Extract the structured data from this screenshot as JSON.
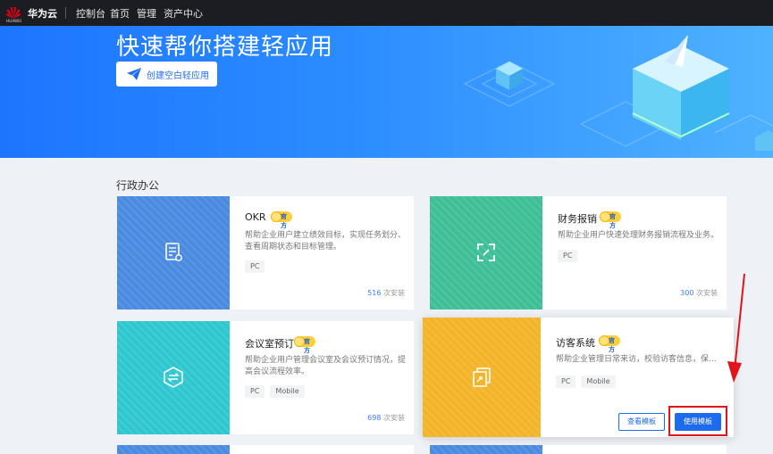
{
  "header": {
    "logo_text": "HUAWEI",
    "brand": "华为云",
    "nav": [
      "控制台",
      "首页",
      "管理",
      "资产中心"
    ]
  },
  "banner": {
    "title": "快速帮你搭建轻应用",
    "create_button": "创建空白轻应用"
  },
  "section": {
    "title": "行政办公"
  },
  "badge_text": "官方",
  "cards": [
    {
      "title": "OKR",
      "desc": "帮助企业用户建立绩效目标，实现任务划分、查看周期状态和目标管理。",
      "tags": [
        "PC"
      ],
      "installs": "516",
      "installs_suffix": "次安装",
      "thumb_color": "#4a8ae0"
    },
    {
      "title": "财务报销",
      "desc": "帮助企业用户快速处理财务报销流程及业务。",
      "tags": [
        "PC"
      ],
      "installs": "300",
      "installs_suffix": "次安装",
      "thumb_color": "#3fbf96"
    },
    {
      "title": "会议室预订",
      "desc": "帮助企业用户管理会议室及会议预订情况，提高会议流程效率。",
      "tags": [
        "PC",
        "Mobile"
      ],
      "installs": "698",
      "installs_suffix": "次安装",
      "thumb_color": "#2fc7cf"
    },
    {
      "title": "访客系统",
      "desc": "帮助企业管理日常来访，校验访客信息，保...",
      "tags": [
        "PC",
        "Mobile"
      ],
      "view_button": "查看模板",
      "use_button": "使用模板",
      "thumb_color": "#f4b42a"
    }
  ],
  "colors": {
    "accent": "#1d6cf0",
    "highlight": "#e0151c"
  }
}
